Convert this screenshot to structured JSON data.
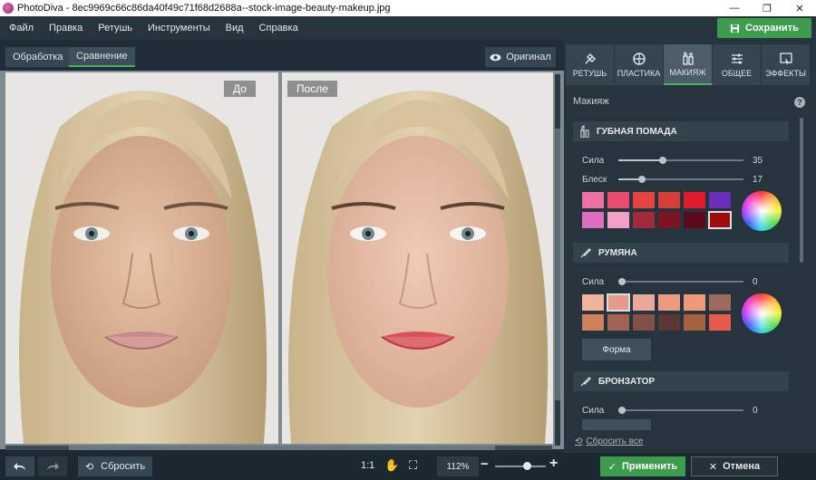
{
  "window": {
    "title": "PhotoDiva - 8ec9969c66c86da40f49c71f68d2688a--stock-image-beauty-makeup.jpg"
  },
  "menu": [
    "Файл",
    "Правка",
    "Ретушь",
    "Инструменты",
    "Вид",
    "Справка"
  ],
  "save_label": "Сохранить",
  "view_tabs": {
    "processing": "Обработка",
    "comparison": "Сравнение"
  },
  "original_label": "Оригинал",
  "before_label": "До",
  "after_label": "После",
  "tools": [
    {
      "label": "РЕТУШЬ",
      "icon": "retouch-icon"
    },
    {
      "label": "ПЛАСТИКА",
      "icon": "plastic-icon"
    },
    {
      "label": "МАКИЯЖ",
      "icon": "makeup-icon"
    },
    {
      "label": "ОБЩЕЕ",
      "icon": "sliders-icon"
    },
    {
      "label": "ЭФФЕКТЫ",
      "icon": "effects-icon"
    }
  ],
  "panel": {
    "title": "Макияж",
    "lipstick": {
      "title": "ГУБНАЯ ПОМАДА",
      "strength_label": "Сила",
      "strength": 35,
      "gloss_label": "Блеск",
      "gloss": 17,
      "colors": [
        "#f06fa7",
        "#ea4b6d",
        "#e7423e",
        "#d83d39",
        "#e31a2e",
        "#6a2dbe",
        "#dd6fc1",
        "#f59fc8",
        "#a02a3b",
        "#7c1422",
        "#5a0a1e",
        "#a20b0b"
      ],
      "selected": 11
    },
    "blush": {
      "title": "РУМЯНА",
      "strength_label": "Сила",
      "strength": 0,
      "colors": [
        "#f0b49c",
        "#e69a8c",
        "#e9a898",
        "#ee9a7c",
        "#ec9a7a",
        "#9c6a5e",
        "#cf8158",
        "#a16352",
        "#835047",
        "#5a3833",
        "#a46240",
        "#e85a4c"
      ],
      "selected": 1,
      "form_label": "Форма"
    },
    "bronzer": {
      "title": "БРОНЗАТОР",
      "strength_label": "Сила",
      "strength": 0
    },
    "reset_all": "Сбросить все"
  },
  "bottom": {
    "reset_label": "Сбросить",
    "ratio_label": "1:1",
    "zoom": "112%",
    "zoom_level": 0.62,
    "apply_label": "Применить",
    "cancel_label": "Отмена"
  }
}
